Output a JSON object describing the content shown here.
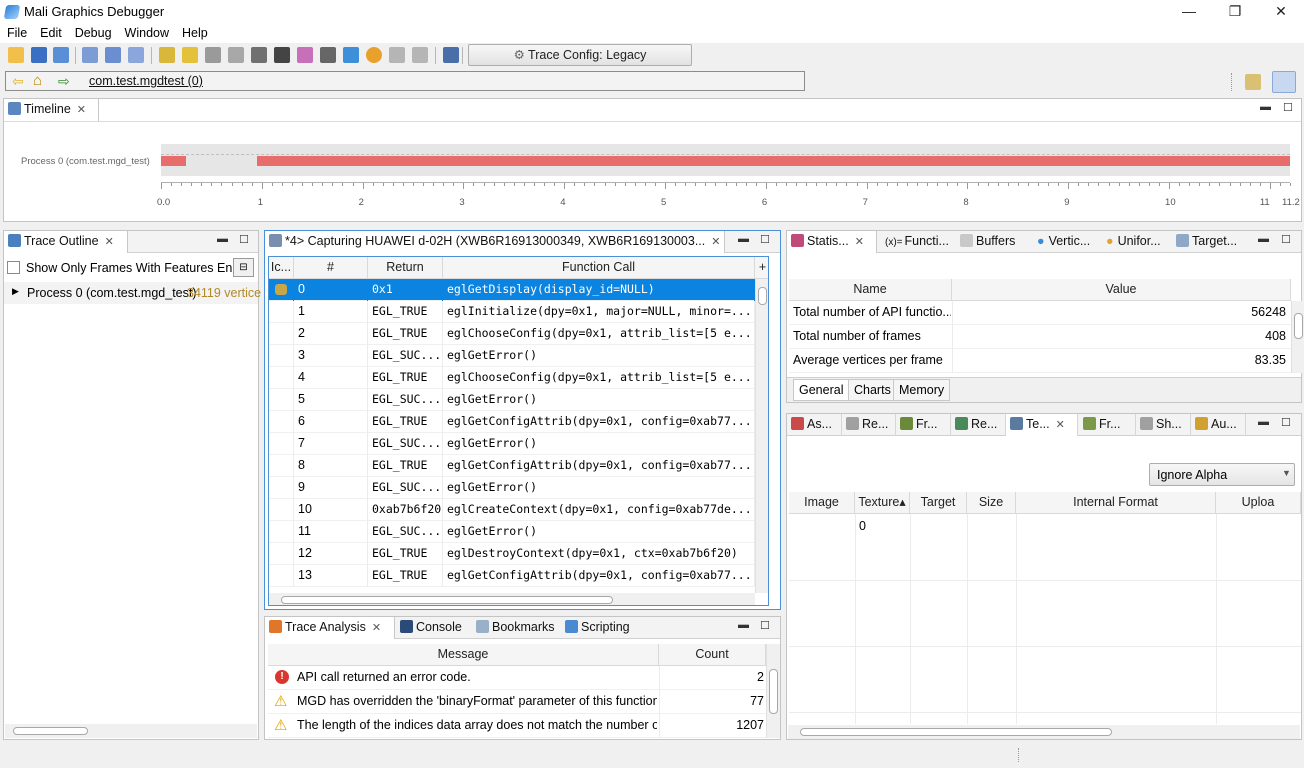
{
  "window": {
    "title": "Mali Graphics Debugger",
    "minimize": "—",
    "maximize": "❐",
    "close": "✕"
  },
  "menu": [
    "File",
    "Edit",
    "Debug",
    "Window",
    "Help"
  ],
  "toolbar": {
    "trace_config": "Trace Config: Legacy"
  },
  "address": {
    "process": "com.test.mgdtest (0)"
  },
  "timeline": {
    "tab": "Timeline",
    "process_label": "Process 0 (com.test.mgd_test)",
    "ticks": [
      "0.0",
      "1",
      "2",
      "3",
      "4",
      "5",
      "6",
      "7",
      "8",
      "9",
      "10",
      "11",
      "11.2"
    ],
    "segments": [
      {
        "start": 0.0,
        "end": 0.25
      },
      {
        "start": 0.95,
        "end": 11.2
      }
    ],
    "axis_max": 11.2
  },
  "trace_outline": {
    "tab": "Trace Outline",
    "filter_label": "Show Only Frames With Features En...",
    "tree_item": "Process 0 (com.test.mgd_test)",
    "tree_item_extra": "34119 vertice"
  },
  "capture": {
    "tab": "*4> Capturing HUAWEI d-02H (XWB6R16913000349, XWB6R169130003...",
    "columns": [
      "Ic...",
      "#",
      "Return",
      "Function Call"
    ],
    "rows": [
      {
        "n": "0",
        "ret": "0x1",
        "call": "eglGetDisplay(display_id=NULL)",
        "selected": true
      },
      {
        "n": "1",
        "ret": "EGL_TRUE",
        "call": "eglInitialize(dpy=0x1, major=NULL, minor=..."
      },
      {
        "n": "2",
        "ret": "EGL_TRUE",
        "call": "eglChooseConfig(dpy=0x1, attrib_list=[5 e..."
      },
      {
        "n": "3",
        "ret": "EGL_SUC...",
        "call": "eglGetError()"
      },
      {
        "n": "4",
        "ret": "EGL_TRUE",
        "call": "eglChooseConfig(dpy=0x1, attrib_list=[5 e..."
      },
      {
        "n": "5",
        "ret": "EGL_SUC...",
        "call": "eglGetError()"
      },
      {
        "n": "6",
        "ret": "EGL_TRUE",
        "call": "eglGetConfigAttrib(dpy=0x1, config=0xab77..."
      },
      {
        "n": "7",
        "ret": "EGL_SUC...",
        "call": "eglGetError()"
      },
      {
        "n": "8",
        "ret": "EGL_TRUE",
        "call": "eglGetConfigAttrib(dpy=0x1, config=0xab77..."
      },
      {
        "n": "9",
        "ret": "EGL_SUC...",
        "call": "eglGetError()"
      },
      {
        "n": "10",
        "ret": "0xab7b6f20",
        "call": "eglCreateContext(dpy=0x1, config=0xab77de..."
      },
      {
        "n": "11",
        "ret": "EGL_SUC...",
        "call": "eglGetError()"
      },
      {
        "n": "12",
        "ret": "EGL_TRUE",
        "call": "eglDestroyContext(dpy=0x1, ctx=0xab7b6f20)"
      },
      {
        "n": "13",
        "ret": "EGL_TRUE",
        "call": "eglGetConfigAttrib(dpy=0x1, config=0xab77..."
      }
    ]
  },
  "analysis": {
    "tabs": [
      "Trace Analysis",
      "Console",
      "Bookmarks",
      "Scripting"
    ],
    "columns": [
      "Message",
      "Count"
    ],
    "rows": [
      {
        "level": "error",
        "msg": "API call returned an error code.",
        "count": "2"
      },
      {
        "level": "warning",
        "msg": "MGD has overridden the 'binaryFormat' parameter of this function.",
        "count": "77"
      },
      {
        "level": "warning",
        "msg": "The length of the indices data array does not match the number o...",
        "count": "1207"
      }
    ]
  },
  "stats": {
    "tabs": [
      "Statis...",
      "Functi...",
      "Buffers",
      "Vertic...",
      "Unifor...",
      "Target..."
    ],
    "columns": [
      "Name",
      "Value"
    ],
    "rows": [
      {
        "name": "Total number of API functio...",
        "value": "56248"
      },
      {
        "name": "Total number of frames",
        "value": "408"
      },
      {
        "name": "Average vertices per frame",
        "value": "83.35"
      }
    ],
    "subtabs": [
      "General",
      "Charts",
      "Memory"
    ]
  },
  "textures": {
    "tabs": [
      "As...",
      "Re...",
      "Fr...",
      "Re...",
      "Te...",
      "Fr...",
      "Sh...",
      "Au..."
    ],
    "dropdown": "Ignore Alpha",
    "columns": [
      "Image",
      "Texture▴",
      "Target",
      "Size",
      "Internal Format",
      "Uploa"
    ],
    "rows": [
      {
        "texture": "0"
      }
    ]
  }
}
